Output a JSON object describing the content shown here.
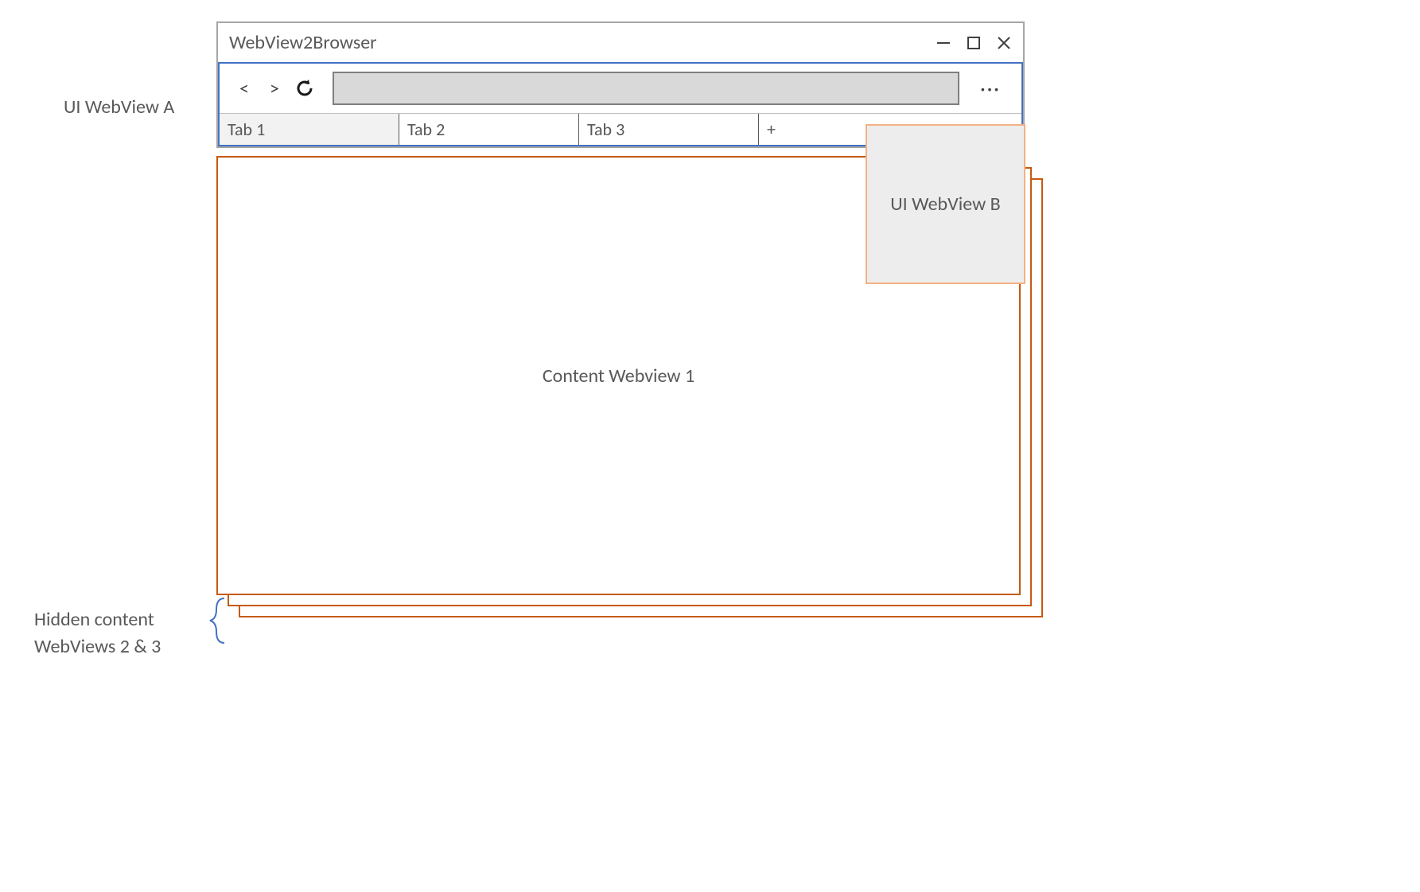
{
  "labels": {
    "ui_webview_a": "UI WebView A",
    "ui_webview_b": "UI WebView B",
    "hidden_line1": "Hidden content",
    "hidden_line2": "WebViews 2 & 3",
    "content_1": "Content Webview 1"
  },
  "window": {
    "title": "WebView2Browser"
  },
  "tabs": [
    {
      "label": "Tab 1",
      "active": true
    },
    {
      "label": "Tab 2",
      "active": false
    },
    {
      "label": "Tab 3",
      "active": false
    },
    {
      "label": "+",
      "active": false
    }
  ],
  "icons": {
    "back": "<",
    "forward": ">",
    "reload": "⟳",
    "more": "···",
    "minimize": "—",
    "maximize": "☐",
    "close": "✕"
  }
}
